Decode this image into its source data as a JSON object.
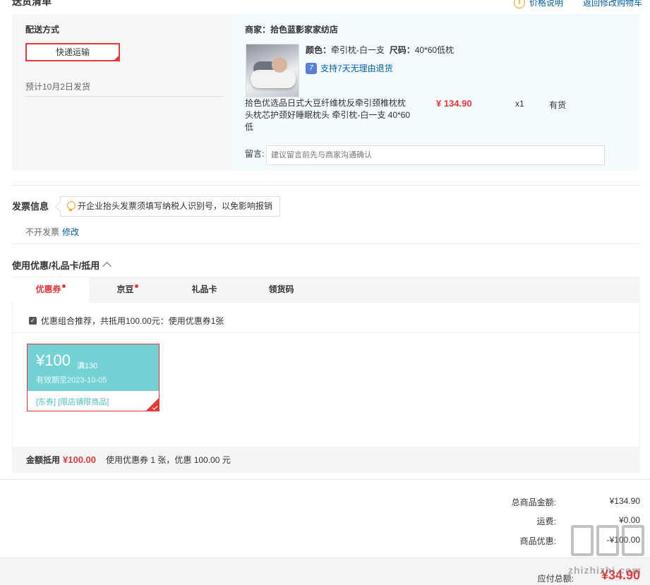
{
  "header": {
    "title": "送货清单",
    "price_note": "价格说明",
    "back_link": "返回修改购物车"
  },
  "delivery": {
    "label": "配送方式",
    "method": "快递运输",
    "ship_date": "预计10月2日发货"
  },
  "shop": {
    "name": "商家：拾色蓝影家家纺店",
    "item": {
      "color_label": "颜色：",
      "color_value": "牵引枕-白一支",
      "size_label": "尺码：",
      "size_value": "40*60低枕",
      "return_policy": "支持7天无理由退货",
      "name": "拾色优选品日式大豆纤维枕反牵引颈椎枕枕头枕芯护颈好睡眠枕头 牵引枕-白一支 40*60低",
      "price": "¥ 134.90",
      "qty": "x1",
      "stock": "有货"
    },
    "message_label": "留言:",
    "message_placeholder": "建议留言前先与商家沟通确认"
  },
  "invoice": {
    "title": "发票信息",
    "tip": "开企业抬头发票须填写纳税人识别号，以免影响报销",
    "status": "不开发票",
    "edit": "修改"
  },
  "coupon": {
    "title": "使用优惠/礼品卡/抵用",
    "tabs": [
      {
        "label": "优惠券"
      },
      {
        "label": "京豆"
      },
      {
        "label": "礼品卡"
      },
      {
        "label": "领货码"
      }
    ],
    "recommend": "优惠组合推荐，共抵用100.00元：使用优惠券1张",
    "card": {
      "amount": "¥100",
      "condition": "满130",
      "expiry": "有效期至2023-10-05",
      "tags": "[东券] [限店铺限商品]"
    },
    "footer": {
      "label": "金额抵用",
      "amount": "¥100.00",
      "desc": "使用优惠券 1 张，优惠 100.00 元"
    }
  },
  "summary": {
    "total_label": "总商品金额:",
    "total_value": "¥134.90",
    "shipping_label": "运费:",
    "shipping_value": "¥0.00",
    "discount_label": "商品优惠:",
    "discount_value": "-¥100.00",
    "pay_label": "应付总额:",
    "pay_value": "¥34.90"
  },
  "watermark": "zhizhizhi.com",
  "colors": {
    "accent": "#e4393c",
    "link": "#005ea7",
    "coupon": "#74d2d4"
  }
}
